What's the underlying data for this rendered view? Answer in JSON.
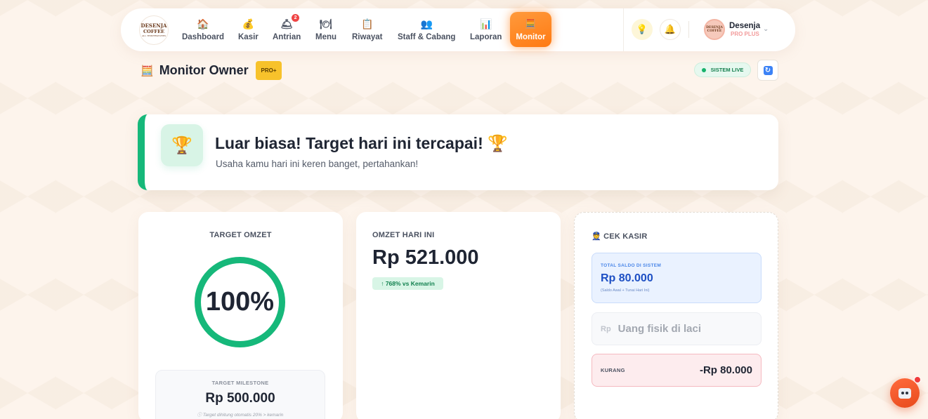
{
  "brand": {
    "logo_line1": "DESENJA",
    "logo_line2": "COFFEE",
    "logo_line3": "ALL TEMPERATURES"
  },
  "nav": {
    "items": [
      {
        "label": "Dashboard",
        "icon": "house-icon",
        "glyph": "🏠"
      },
      {
        "label": "Kasir",
        "icon": "money-bag-icon",
        "glyph": "💰"
      },
      {
        "label": "Antrian",
        "icon": "service-bell-icon",
        "glyph": "🛎",
        "badge": "2"
      },
      {
        "label": "Menu",
        "icon": "plate-icon",
        "glyph": "🍽"
      },
      {
        "label": "Riwayat",
        "icon": "receipt-icon",
        "glyph": "📋"
      },
      {
        "label": "Staff & Cabang",
        "icon": "people-icon",
        "glyph": "👥"
      },
      {
        "label": "Laporan",
        "icon": "bar-chart-icon",
        "glyph": "📊"
      },
      {
        "label": "Monitor",
        "icon": "calculator-icon",
        "glyph": "🧮",
        "active": true
      }
    ]
  },
  "header_actions": {
    "idea_glyph": "💡",
    "bell_glyph": "🔔"
  },
  "profile": {
    "name": "Desenja",
    "plan": "PRO PLUS",
    "avatar_line1": "DESENJA",
    "avatar_line2": "COFFEE"
  },
  "page": {
    "title": "Monitor Owner",
    "title_glyph": "🧮",
    "badge": "PRO+",
    "status": "SISTEM LIVE",
    "refresh_glyph": "↻"
  },
  "banner": {
    "glyph": "🏆",
    "title": "Luar biasa! Target hari ini tercapai! 🏆",
    "subtitle": "Usaha kamu hari ini keren banget, pertahankan!"
  },
  "target_card": {
    "label": "TARGET OMZET",
    "progress_text": "100%",
    "progress_value": 1.0,
    "milestone_label": "TARGET MILESTONE",
    "milestone_value": "Rp 500.000",
    "milestone_note": "ⓘ Target dihitung otomatis 20% > kemarin"
  },
  "omzet_card": {
    "label": "OMZET HARI INI",
    "value": "Rp 521.000",
    "delta": "↑ 768% vs Kemarin"
  },
  "cek_kasir": {
    "label": "👮 CEK KASIR",
    "saldo_label": "TOTAL SALDO DI SISTEM",
    "saldo_value": "Rp 80.000",
    "saldo_note": "(Saldo Awal + Tunai Hari Ini)",
    "input_prefix": "Rp",
    "input_placeholder": "Uang fisik di laci",
    "input_value": "",
    "kurang_label": "KURANG",
    "kurang_value": "-Rp 80.000"
  },
  "colors": {
    "accent": "#ff8a1f",
    "success": "#16b87a",
    "info": "#1d4fc4",
    "danger": "#ef4444"
  }
}
